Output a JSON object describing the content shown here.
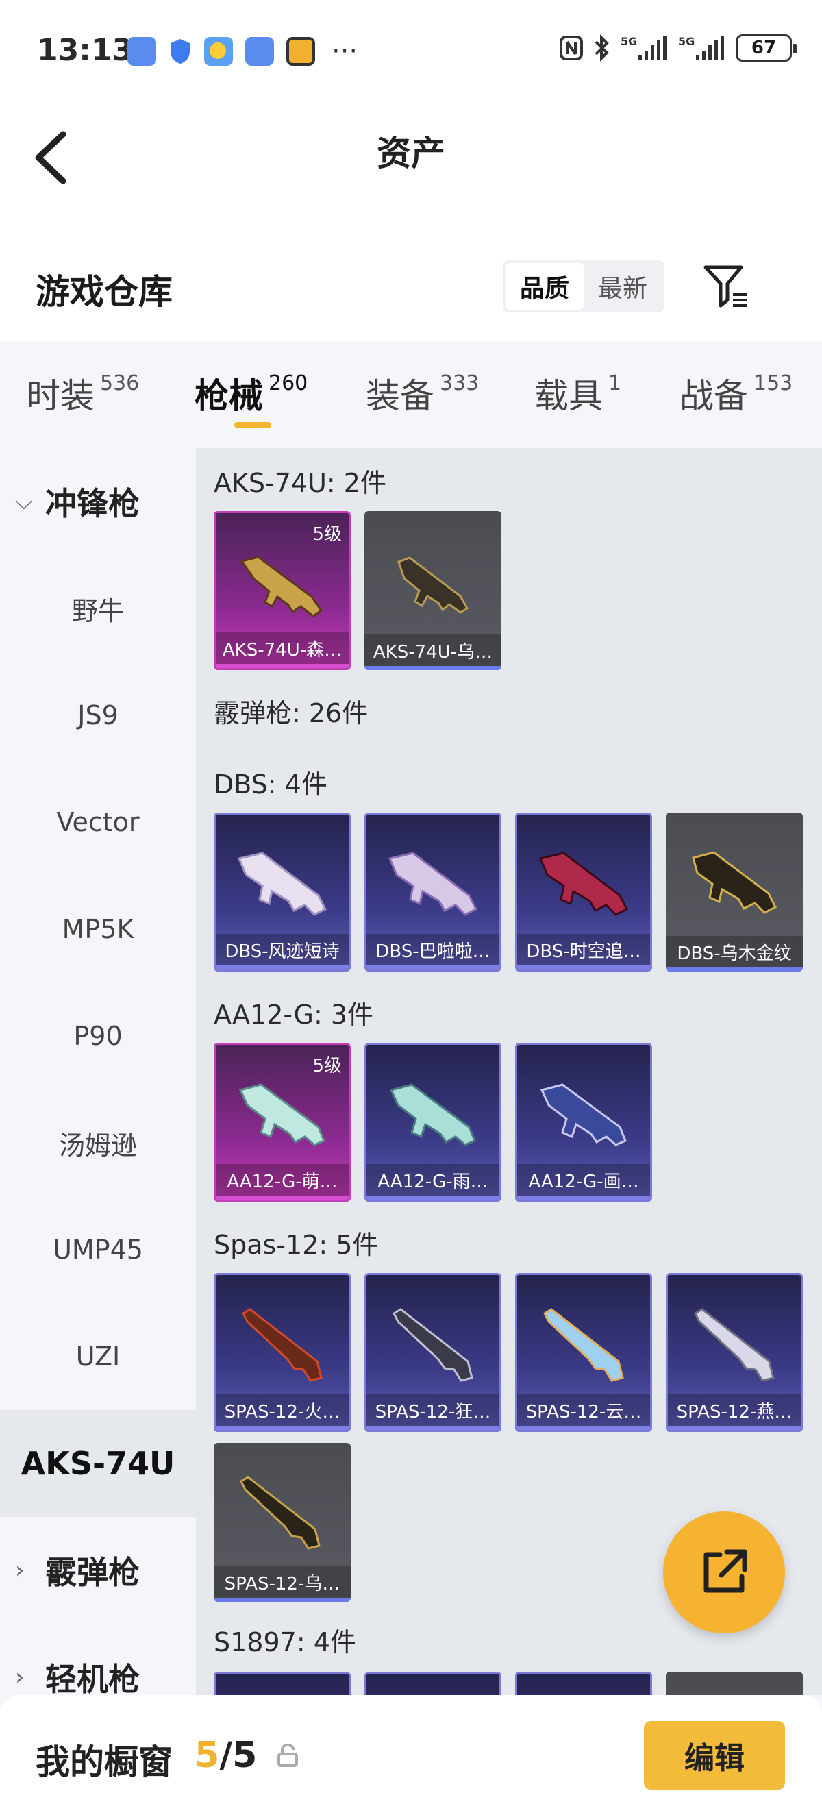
{
  "status": {
    "time": "13:13",
    "battery": "67"
  },
  "header": {
    "title": "资产"
  },
  "warehouse": {
    "title": "游戏仓库",
    "sort_quality": "品质",
    "sort_latest": "最新"
  },
  "tabs": [
    {
      "label": "时装",
      "count": "536"
    },
    {
      "label": "枪械",
      "count": "260"
    },
    {
      "label": "装备",
      "count": "333"
    },
    {
      "label": "载具",
      "count": "1"
    },
    {
      "label": "战备",
      "count": "153"
    }
  ],
  "sidebar": {
    "group_smg": "冲锋枪",
    "items": [
      "野牛",
      "JS9",
      "Vector",
      "MP5K",
      "P90",
      "汤姆逊",
      "UMP45",
      "UZI",
      "AKS-74U"
    ],
    "group_shotgun": "霰弹枪",
    "group_lmg": "轻机枪"
  },
  "sections": {
    "aks": "AKS-74U: 2件",
    "shotgun": "霰弹枪: 26件",
    "dbs": "DBS: 4件",
    "aa12": "AA12-G: 3件",
    "spas": "Spas-12: 5件",
    "s1897": "S1897: 4件"
  },
  "cards": {
    "aks": [
      {
        "name": "AKS-74U-森…",
        "level": "5级"
      },
      {
        "name": "AKS-74U-乌…"
      }
    ],
    "dbs": [
      {
        "name": "DBS-风迹短诗"
      },
      {
        "name": "DBS-巴啦啦…"
      },
      {
        "name": "DBS-时空追…"
      },
      {
        "name": "DBS-乌木金纹"
      }
    ],
    "aa12": [
      {
        "name": "AA12-G-萌…",
        "level": "5级"
      },
      {
        "name": "AA12-G-雨…"
      },
      {
        "name": "AA12-G-画…"
      }
    ],
    "spas": [
      {
        "name": "SPAS-12-火…"
      },
      {
        "name": "SPAS-12-狂…"
      },
      {
        "name": "SPAS-12-云…"
      },
      {
        "name": "SPAS-12-燕…"
      },
      {
        "name": "SPAS-12-乌…"
      }
    ]
  },
  "bottom": {
    "label": "我的橱窗",
    "current": "5",
    "total": "/5",
    "edit": "编辑"
  },
  "colors": {
    "accent": "#f5b52e",
    "pink_rarity": "#c13fb6",
    "purple_rarity": "#7a7ad6"
  }
}
